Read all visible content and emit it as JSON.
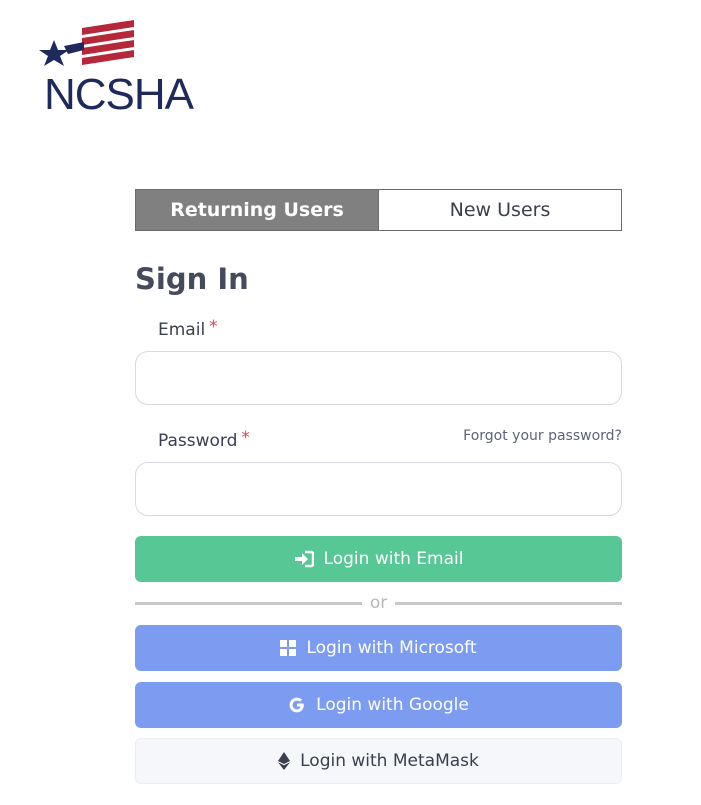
{
  "logo": {
    "text": "NCSHA",
    "accent": "#b5283a",
    "navy": "#1f2a5c"
  },
  "tabs": [
    {
      "label": "Returning Users",
      "active": true
    },
    {
      "label": "New Users",
      "active": false
    }
  ],
  "form": {
    "title": "Sign In",
    "email_label": "Email",
    "password_label": "Password",
    "required_mark": "*",
    "email_value": "",
    "password_value": "",
    "forgot_link": "Forgot your password?"
  },
  "buttons": {
    "email": "Login with Email",
    "microsoft": "Login with Microsoft",
    "google": "Login with Google",
    "metamask": "Login with MetaMask"
  },
  "divider_text": "or",
  "colors": {
    "email_button": "#56c795",
    "sso_button": "#7b9cf0",
    "metamask_button": "#f6f7fb",
    "active_tab": "#808080",
    "required": "#d6455a"
  },
  "icons": {
    "email": "sign-in-icon",
    "microsoft": "windows-icon",
    "google": "google-icon",
    "metamask": "ethereum-icon"
  }
}
